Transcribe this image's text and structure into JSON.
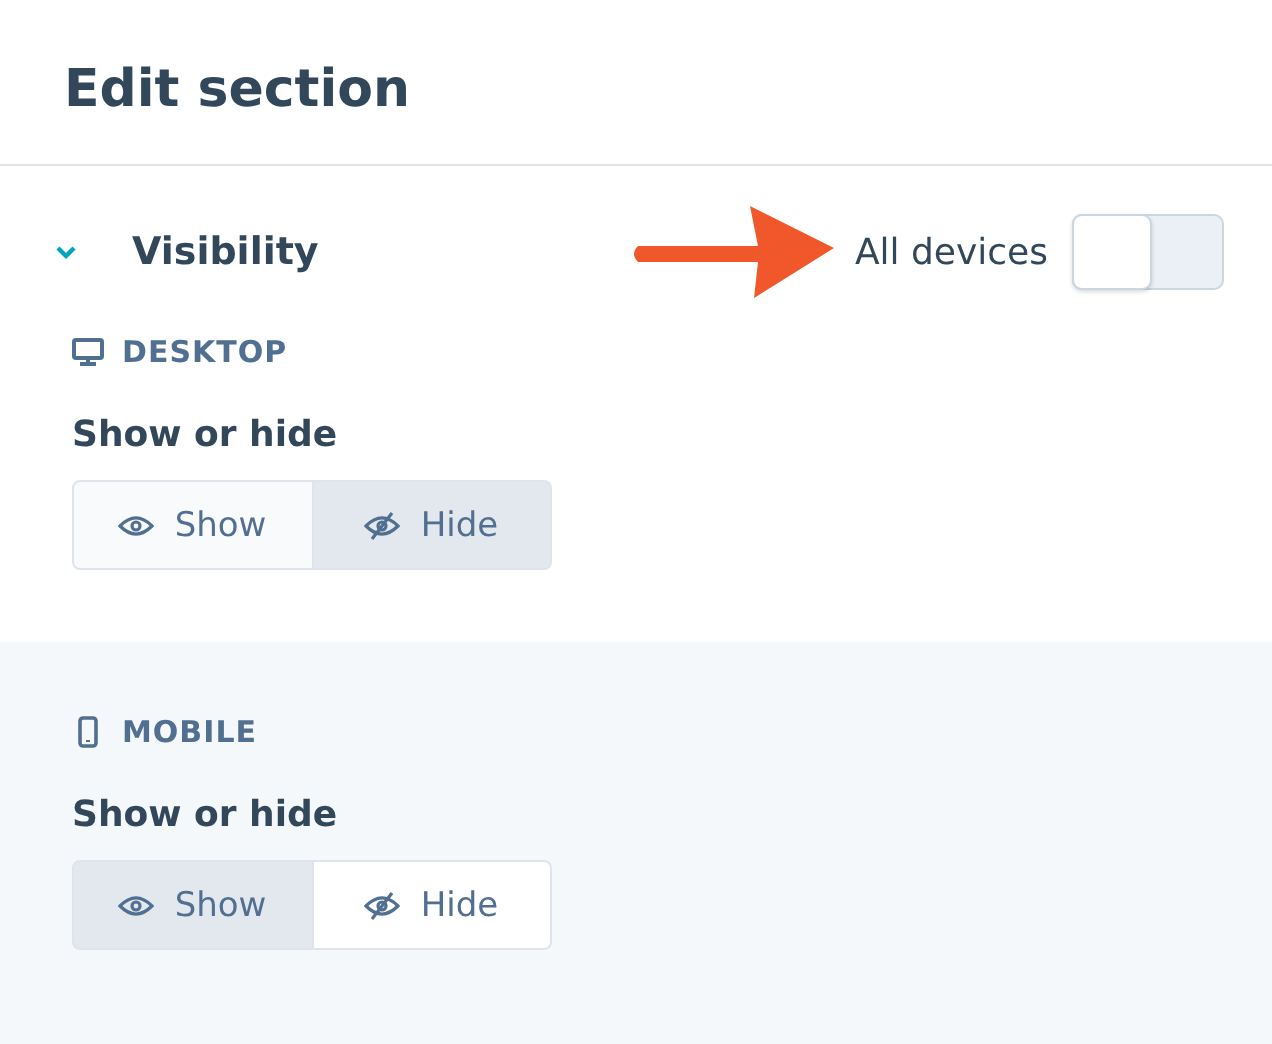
{
  "panel": {
    "title": "Edit section"
  },
  "visibility": {
    "label": "Visibility",
    "expanded": true,
    "toggle_label": "All devices",
    "all_devices_on": false
  },
  "devices": [
    {
      "kind": "desktop",
      "name": "DESKTOP",
      "field_label": "Show or hide",
      "options": [
        {
          "kind": "show",
          "label": "Show",
          "selected": false
        },
        {
          "kind": "hide",
          "label": "Hide",
          "selected": true
        }
      ]
    },
    {
      "kind": "mobile",
      "name": "MOBILE",
      "field_label": "Show or hide",
      "options": [
        {
          "kind": "show",
          "label": "Show",
          "selected": true
        },
        {
          "kind": "hide",
          "label": "Hide",
          "selected": false
        }
      ]
    }
  ]
}
